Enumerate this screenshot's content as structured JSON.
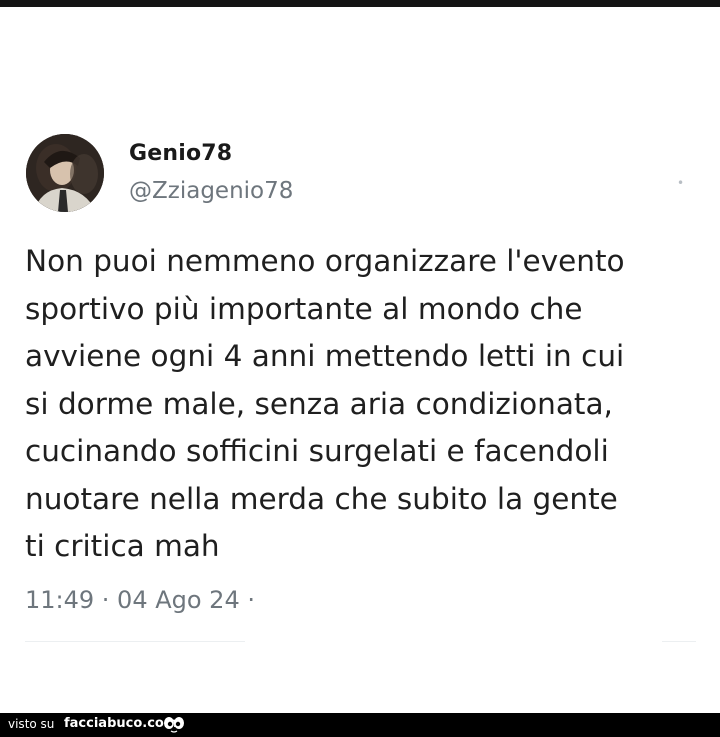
{
  "tweet": {
    "display_name": "Genio78",
    "handle": "@Zziagenio78",
    "text": "Non puoi nemmeno organizzare l'evento\nsportivo più importante al mondo che\navviene ogni 4 anni mettendo letti in cui\nsi dorme male, senza aria condizionata,\ncucinando sofficini surgelati e facendoli\nnuotare nella merda che subito la gente\nti critica mah",
    "meta": "11:49 · 04 Ago 24 ·"
  },
  "footer": {
    "prefix": "visto su",
    "brand": "facciabuco.com"
  }
}
